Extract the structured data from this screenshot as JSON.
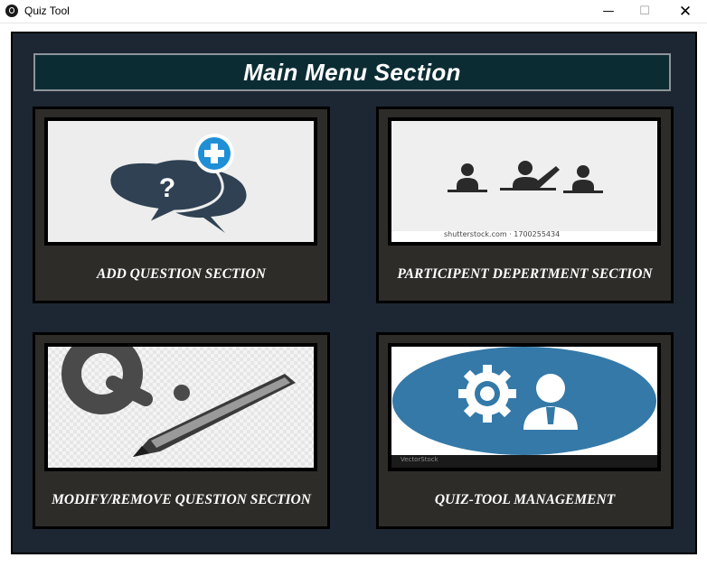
{
  "window": {
    "title": "Quiz Tool",
    "minimize_glyph": "—",
    "maximize_glyph": "☐",
    "close_glyph": "✕"
  },
  "main": {
    "title": "Main Menu Section",
    "cards": [
      {
        "label": "ADD QUESTION SECTION",
        "icon": "speech-bubbles-question-plus-icon"
      },
      {
        "label": "PARTICIPENT DEPERTMENT SECTION",
        "icon": "participants-raised-hand-icon",
        "image_caption": "shutterstock.com · 1700255434"
      },
      {
        "label": "MODIFY/REMOVE QUESTION SECTION",
        "icon": "q-pencil-icon"
      },
      {
        "label": "QUIZ-TOOL MANAGEMENT",
        "icon": "gear-person-icon",
        "image_caption_left": "VectorStock"
      }
    ]
  },
  "colors": {
    "frame_bg": "#1d2733",
    "header_bg": "#0c2c34",
    "card_bg": "#2e2c29",
    "bubble_dark": "#2f4152",
    "plus_blue": "#1f8fd6",
    "management_blue": "#3479a8"
  }
}
